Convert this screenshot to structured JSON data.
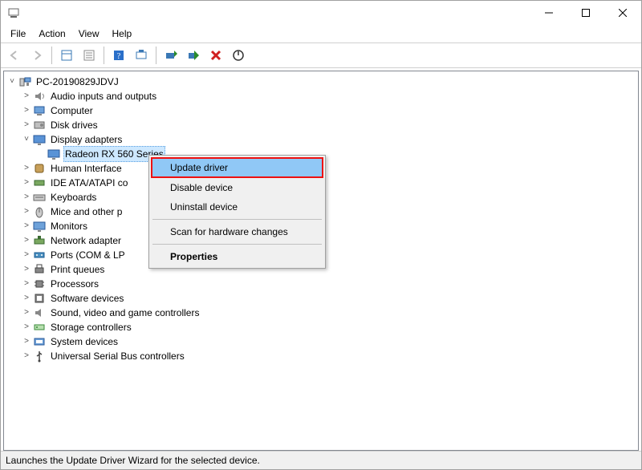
{
  "menubar": {
    "file": "File",
    "action": "Action",
    "view": "View",
    "help": "Help"
  },
  "tree": {
    "root": "PC-20190829JDVJ",
    "items": [
      {
        "label": "Audio inputs and outputs",
        "icon": "audio"
      },
      {
        "label": "Computer",
        "icon": "computer"
      },
      {
        "label": "Disk drives",
        "icon": "disk"
      },
      {
        "label": "Display adapters",
        "icon": "display",
        "expanded": true,
        "children": [
          {
            "label": "Radeon RX 560 Series",
            "icon": "display",
            "selected": true
          }
        ]
      },
      {
        "label": "Human Interface",
        "icon": "hid"
      },
      {
        "label": "IDE ATA/ATAPI co",
        "icon": "ide"
      },
      {
        "label": "Keyboards",
        "icon": "keyboard"
      },
      {
        "label": "Mice and other p",
        "icon": "mouse"
      },
      {
        "label": "Monitors",
        "icon": "monitor"
      },
      {
        "label": "Network adapter",
        "icon": "network"
      },
      {
        "label": "Ports (COM & LP",
        "icon": "port"
      },
      {
        "label": "Print queues",
        "icon": "printer"
      },
      {
        "label": "Processors",
        "icon": "cpu"
      },
      {
        "label": "Software devices",
        "icon": "software"
      },
      {
        "label": "Sound, video and game controllers",
        "icon": "sound"
      },
      {
        "label": "Storage controllers",
        "icon": "storage"
      },
      {
        "label": "System devices",
        "icon": "system"
      },
      {
        "label": "Universal Serial Bus controllers",
        "icon": "usb"
      }
    ]
  },
  "context_menu": {
    "update": "Update driver",
    "disable": "Disable device",
    "uninstall": "Uninstall device",
    "scan": "Scan for hardware changes",
    "properties": "Properties"
  },
  "statusbar": "Launches the Update Driver Wizard for the selected device."
}
